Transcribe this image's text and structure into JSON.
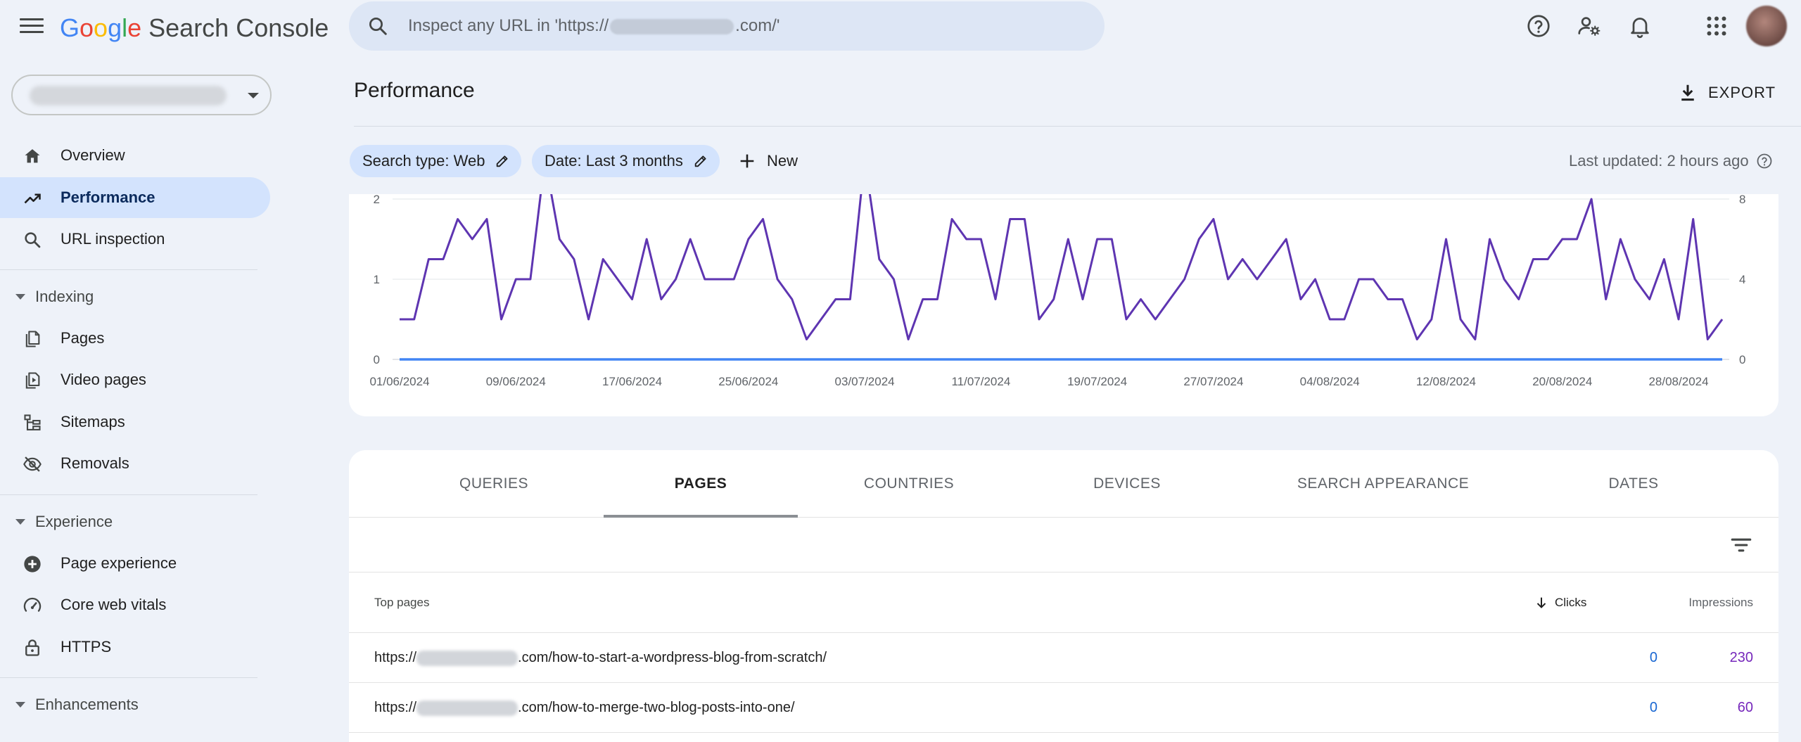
{
  "app": {
    "logo_letters": [
      "G",
      "o",
      "o",
      "g",
      "l",
      "e"
    ],
    "product": "Search Console"
  },
  "search": {
    "prefix": "Inspect any URL in 'https://",
    "suffix": ".com/'"
  },
  "icons": {
    "menu": "hamburger-menu-icon",
    "search": "search-icon",
    "help": "help-icon",
    "admin": "manage-users-icon",
    "notifications": "bell-icon",
    "apps": "apps-grid-icon"
  },
  "sidebar": {
    "items_top": [
      {
        "label": "Overview",
        "icon": "home-icon"
      },
      {
        "label": "Performance",
        "icon": "trending-up-icon",
        "active": true
      },
      {
        "label": "URL inspection",
        "icon": "search-icon"
      }
    ],
    "sections": [
      {
        "label": "Indexing",
        "items": [
          {
            "label": "Pages",
            "icon": "pages-icon"
          },
          {
            "label": "Video pages",
            "icon": "video-icon"
          },
          {
            "label": "Sitemaps",
            "icon": "sitemap-icon"
          },
          {
            "label": "Removals",
            "icon": "eye-off-icon"
          }
        ]
      },
      {
        "label": "Experience",
        "items": [
          {
            "label": "Page experience",
            "icon": "plus-circle-icon"
          },
          {
            "label": "Core web vitals",
            "icon": "gauge-icon"
          },
          {
            "label": "HTTPS",
            "icon": "lock-icon"
          }
        ]
      },
      {
        "label": "Enhancements",
        "items": []
      }
    ]
  },
  "main": {
    "title": "Performance",
    "export_label": "EXPORT",
    "chips": [
      {
        "label": "Search type: Web"
      },
      {
        "label": "Date: Last 3 months"
      }
    ],
    "new_label": "New",
    "last_updated": "Last updated: 2 hours ago"
  },
  "chart_data": {
    "type": "line",
    "x_tick_labels": [
      "01/06/2024",
      "09/06/2024",
      "17/06/2024",
      "25/06/2024",
      "03/07/2024",
      "11/07/2024",
      "19/07/2024",
      "27/07/2024",
      "04/08/2024",
      "12/08/2024",
      "20/08/2024",
      "28/08/2024"
    ],
    "y_left_ticks": [
      "0",
      "1",
      "2"
    ],
    "y_right_ticks": [
      "0",
      "4",
      "8"
    ],
    "ylim_left": [
      0,
      2
    ],
    "ylim_right": [
      0,
      8
    ],
    "grid": true,
    "series": [
      {
        "axis": "right",
        "color": "#5e35b1",
        "values": [
          2,
          2,
          5,
          5,
          7,
          6,
          7,
          2,
          4,
          4,
          10,
          6,
          5,
          2,
          5,
          4,
          3,
          6,
          3,
          4,
          6,
          4,
          4,
          4,
          6,
          7,
          4,
          3,
          1,
          2,
          3,
          3,
          10,
          5,
          4,
          1,
          3,
          3,
          7,
          6,
          6,
          3,
          7,
          7,
          2,
          3,
          6,
          3,
          6,
          6,
          2,
          3,
          2,
          3,
          4,
          6,
          7,
          4,
          5,
          4,
          5,
          6,
          3,
          4,
          2,
          2,
          4,
          4,
          3,
          3,
          1,
          2,
          6,
          2,
          1,
          6,
          4,
          3,
          5,
          5,
          6,
          6,
          8,
          3,
          6,
          4,
          3,
          5,
          2,
          7,
          1,
          2
        ]
      },
      {
        "axis": "left",
        "color": "#4285f4",
        "values": [
          0,
          0,
          0,
          0,
          0,
          0,
          0,
          0,
          0,
          0,
          0,
          0,
          0,
          0,
          0,
          0,
          0,
          0,
          0,
          0,
          0,
          0,
          0,
          0,
          0,
          0,
          0,
          0,
          0,
          0,
          0,
          0,
          0,
          0,
          0,
          0,
          0,
          0,
          0,
          0,
          0,
          0,
          0,
          0,
          0,
          0,
          0,
          0,
          0,
          0,
          0,
          0,
          0,
          0,
          0,
          0,
          0,
          0,
          0,
          0,
          0,
          0,
          0,
          0,
          0,
          0,
          0,
          0,
          0,
          0,
          0,
          0,
          0,
          0,
          0,
          0,
          0,
          0,
          0,
          0,
          0,
          0,
          0,
          0,
          0,
          0,
          0,
          0,
          0,
          0,
          0,
          0
        ]
      }
    ]
  },
  "table": {
    "tabs": [
      "QUERIES",
      "PAGES",
      "COUNTRIES",
      "DEVICES",
      "SEARCH APPEARANCE",
      "DATES"
    ],
    "active_tab": "PAGES",
    "headers": {
      "pages": "Top pages",
      "clicks": "Clicks",
      "impressions": "Impressions"
    },
    "rows": [
      {
        "prefix": "https://",
        "path": ".com/how-to-start-a-wordpress-blog-from-scratch/",
        "clicks": "0",
        "impressions": "230"
      },
      {
        "prefix": "https://",
        "path": ".com/how-to-merge-two-blog-posts-into-one/",
        "clicks": "0",
        "impressions": "60"
      }
    ]
  }
}
